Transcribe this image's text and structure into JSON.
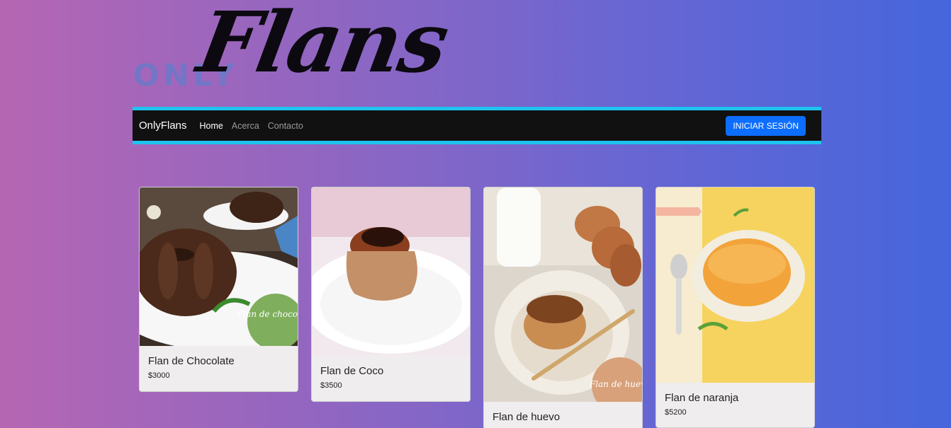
{
  "logo": {
    "only": "ONLY",
    "flans": "Flans"
  },
  "navbar": {
    "brand": "OnlyFlans",
    "links": [
      {
        "label": "Home",
        "active": true
      },
      {
        "label": "Acerca",
        "active": false
      },
      {
        "label": "Contacto",
        "active": false
      }
    ],
    "login_label": "INICIAR SESIÓN"
  },
  "products": [
    {
      "name": "Flan de Chocolate",
      "price": "$3000",
      "image_badge": "Flan de chocolate"
    },
    {
      "name": "Flan de Coco",
      "price": "$3500"
    },
    {
      "name": "Flan de huevo",
      "price": "",
      "image_badge": "Flan de huevo"
    },
    {
      "name": "Flan de naranja",
      "price": "$5200"
    }
  ],
  "colors": {
    "navbar_bg": "#111111",
    "navbar_border": "#1ec3ef",
    "button_primary": "#0d6efd",
    "card_bg": "#efeded"
  }
}
